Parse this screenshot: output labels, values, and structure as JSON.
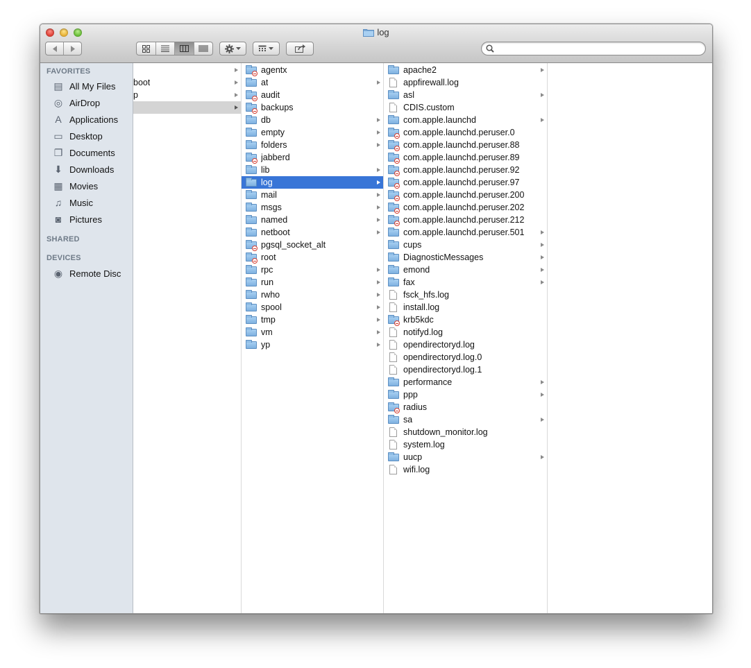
{
  "window": {
    "title": "log"
  },
  "toolbar": {
    "view_icons": [
      "icon-view-icon",
      "list-view-icon",
      "column-view-icon",
      "coverflow-view-icon"
    ],
    "search_placeholder": ""
  },
  "sidebar": {
    "favorites_heading": "FAVORITES",
    "favorites": [
      {
        "label": "All My Files",
        "icon": "all-files-icon"
      },
      {
        "label": "AirDrop",
        "icon": "airdrop-icon"
      },
      {
        "label": "Applications",
        "icon": "applications-icon"
      },
      {
        "label": "Desktop",
        "icon": "desktop-icon"
      },
      {
        "label": "Documents",
        "icon": "documents-icon"
      },
      {
        "label": "Downloads",
        "icon": "downloads-icon"
      },
      {
        "label": "Movies",
        "icon": "movies-icon"
      },
      {
        "label": "Music",
        "icon": "music-icon"
      },
      {
        "label": "Pictures",
        "icon": "pictures-icon"
      }
    ],
    "shared_heading": "SHARED",
    "devices_heading": "DEVICES",
    "devices": [
      {
        "label": "Remote Disc",
        "icon": "disc-icon"
      }
    ]
  },
  "columns": [
    {
      "items": [
        {
          "name": "",
          "kind": "none",
          "arrow": true,
          "state": ""
        },
        {
          "name": "boot",
          "kind": "none",
          "arrow": true,
          "state": ""
        },
        {
          "name": "p",
          "kind": "none",
          "arrow": true,
          "state": ""
        },
        {
          "name": "",
          "kind": "none",
          "arrow": true,
          "state": "hi"
        }
      ]
    },
    {
      "items": [
        {
          "name": "agentx",
          "kind": "folder-locked",
          "arrow": false,
          "state": ""
        },
        {
          "name": "at",
          "kind": "folder",
          "arrow": true,
          "state": ""
        },
        {
          "name": "audit",
          "kind": "folder-locked",
          "arrow": false,
          "state": ""
        },
        {
          "name": "backups",
          "kind": "folder-locked",
          "arrow": false,
          "state": ""
        },
        {
          "name": "db",
          "kind": "folder",
          "arrow": true,
          "state": ""
        },
        {
          "name": "empty",
          "kind": "folder",
          "arrow": true,
          "state": ""
        },
        {
          "name": "folders",
          "kind": "folder",
          "arrow": true,
          "state": ""
        },
        {
          "name": "jabberd",
          "kind": "folder-locked",
          "arrow": false,
          "state": ""
        },
        {
          "name": "lib",
          "kind": "folder",
          "arrow": true,
          "state": ""
        },
        {
          "name": "log",
          "kind": "folder",
          "arrow": true,
          "state": "sel"
        },
        {
          "name": "mail",
          "kind": "folder",
          "arrow": true,
          "state": ""
        },
        {
          "name": "msgs",
          "kind": "folder",
          "arrow": true,
          "state": ""
        },
        {
          "name": "named",
          "kind": "folder",
          "arrow": true,
          "state": ""
        },
        {
          "name": "netboot",
          "kind": "folder",
          "arrow": true,
          "state": ""
        },
        {
          "name": "pgsql_socket_alt",
          "kind": "folder-locked",
          "arrow": false,
          "state": ""
        },
        {
          "name": "root",
          "kind": "folder-locked",
          "arrow": false,
          "state": ""
        },
        {
          "name": "rpc",
          "kind": "folder",
          "arrow": true,
          "state": ""
        },
        {
          "name": "run",
          "kind": "folder",
          "arrow": true,
          "state": ""
        },
        {
          "name": "rwho",
          "kind": "folder",
          "arrow": true,
          "state": ""
        },
        {
          "name": "spool",
          "kind": "folder",
          "arrow": true,
          "state": ""
        },
        {
          "name": "tmp",
          "kind": "folder",
          "arrow": true,
          "state": ""
        },
        {
          "name": "vm",
          "kind": "folder",
          "arrow": true,
          "state": ""
        },
        {
          "name": "yp",
          "kind": "folder",
          "arrow": true,
          "state": ""
        }
      ]
    },
    {
      "items": [
        {
          "name": "apache2",
          "kind": "folder",
          "arrow": true,
          "state": ""
        },
        {
          "name": "appfirewall.log",
          "kind": "file",
          "arrow": false,
          "state": ""
        },
        {
          "name": "asl",
          "kind": "folder",
          "arrow": true,
          "state": ""
        },
        {
          "name": "CDIS.custom",
          "kind": "file",
          "arrow": false,
          "state": ""
        },
        {
          "name": "com.apple.launchd",
          "kind": "folder",
          "arrow": true,
          "state": ""
        },
        {
          "name": "com.apple.launchd.peruser.0",
          "kind": "folder-locked",
          "arrow": false,
          "state": ""
        },
        {
          "name": "com.apple.launchd.peruser.88",
          "kind": "folder-locked",
          "arrow": false,
          "state": ""
        },
        {
          "name": "com.apple.launchd.peruser.89",
          "kind": "folder-locked",
          "arrow": false,
          "state": ""
        },
        {
          "name": "com.apple.launchd.peruser.92",
          "kind": "folder-locked",
          "arrow": false,
          "state": ""
        },
        {
          "name": "com.apple.launchd.peruser.97",
          "kind": "folder-locked",
          "arrow": false,
          "state": ""
        },
        {
          "name": "com.apple.launchd.peruser.200",
          "kind": "folder-locked",
          "arrow": false,
          "state": ""
        },
        {
          "name": "com.apple.launchd.peruser.202",
          "kind": "folder-locked",
          "arrow": false,
          "state": ""
        },
        {
          "name": "com.apple.launchd.peruser.212",
          "kind": "folder-locked",
          "arrow": false,
          "state": ""
        },
        {
          "name": "com.apple.launchd.peruser.501",
          "kind": "folder",
          "arrow": true,
          "state": ""
        },
        {
          "name": "cups",
          "kind": "folder",
          "arrow": true,
          "state": ""
        },
        {
          "name": "DiagnosticMessages",
          "kind": "folder",
          "arrow": true,
          "state": ""
        },
        {
          "name": "emond",
          "kind": "folder",
          "arrow": true,
          "state": ""
        },
        {
          "name": "fax",
          "kind": "folder",
          "arrow": true,
          "state": ""
        },
        {
          "name": "fsck_hfs.log",
          "kind": "file",
          "arrow": false,
          "state": ""
        },
        {
          "name": "install.log",
          "kind": "file",
          "arrow": false,
          "state": ""
        },
        {
          "name": "krb5kdc",
          "kind": "folder-locked",
          "arrow": false,
          "state": ""
        },
        {
          "name": "notifyd.log",
          "kind": "file",
          "arrow": false,
          "state": ""
        },
        {
          "name": "opendirectoryd.log",
          "kind": "file",
          "arrow": false,
          "state": ""
        },
        {
          "name": "opendirectoryd.log.0",
          "kind": "file",
          "arrow": false,
          "state": ""
        },
        {
          "name": "opendirectoryd.log.1",
          "kind": "file",
          "arrow": false,
          "state": ""
        },
        {
          "name": "performance",
          "kind": "folder",
          "arrow": true,
          "state": ""
        },
        {
          "name": "ppp",
          "kind": "folder",
          "arrow": true,
          "state": ""
        },
        {
          "name": "radius",
          "kind": "folder-locked",
          "arrow": false,
          "state": ""
        },
        {
          "name": "sa",
          "kind": "folder",
          "arrow": true,
          "state": ""
        },
        {
          "name": "shutdown_monitor.log",
          "kind": "file",
          "arrow": false,
          "state": ""
        },
        {
          "name": "system.log",
          "kind": "file",
          "arrow": false,
          "state": ""
        },
        {
          "name": "uucp",
          "kind": "folder",
          "arrow": true,
          "state": ""
        },
        {
          "name": "wifi.log",
          "kind": "file",
          "arrow": false,
          "state": ""
        }
      ]
    },
    {
      "items": []
    }
  ],
  "colors": {
    "selection": "#3875d7",
    "sidebar_bg": "#dfe5ec",
    "highlight": "#d4d4d4"
  }
}
